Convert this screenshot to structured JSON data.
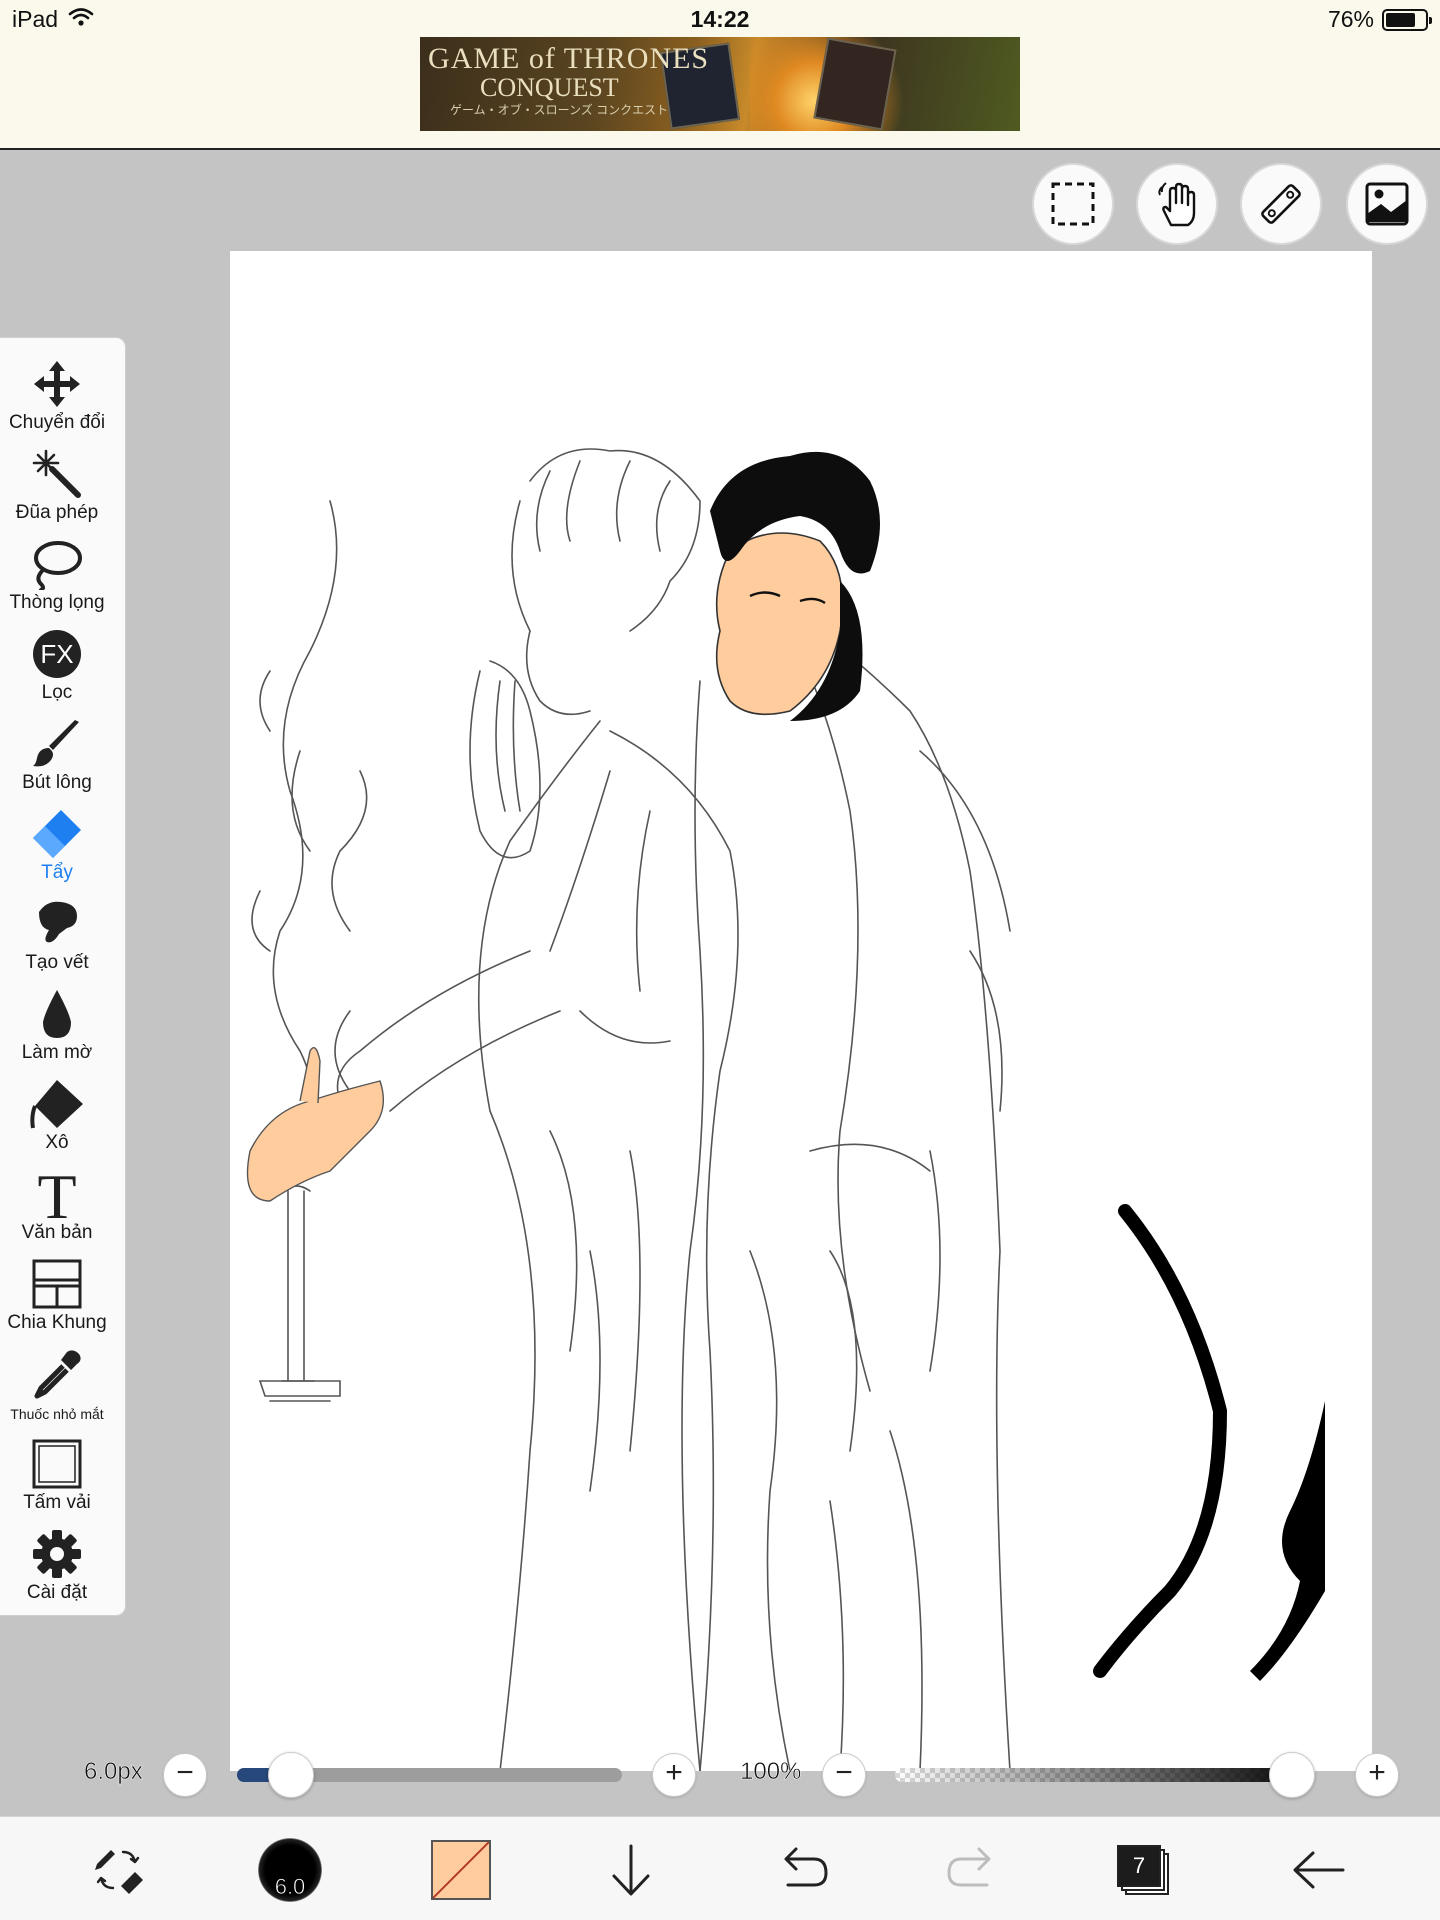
{
  "status_bar": {
    "device": "iPad",
    "time": "14:22",
    "battery": "76%",
    "battery_level": 0.76
  },
  "ad": {
    "title": "GAME of THRONES",
    "subtitle": "CONQUEST",
    "tagline": "ゲーム・オブ・スローンズ コンクエスト"
  },
  "top_tools": [
    {
      "name": "selection-icon"
    },
    {
      "name": "hand-icon"
    },
    {
      "name": "ruler-icon"
    },
    {
      "name": "image-icon"
    }
  ],
  "left_tools": [
    {
      "label": "Chuyển đổi",
      "icon": "move-icon",
      "active": false
    },
    {
      "label": "Đũa phép",
      "icon": "magic-wand-icon",
      "active": false
    },
    {
      "label": "Thòng lọng",
      "icon": "lasso-icon",
      "active": false
    },
    {
      "label": "Lọc",
      "icon": "fx-filter-icon",
      "active": false
    },
    {
      "label": "Bút lông",
      "icon": "brush-icon",
      "active": false
    },
    {
      "label": "Tẩy",
      "icon": "eraser-icon",
      "active": true
    },
    {
      "label": "Tạo vết",
      "icon": "smudge-icon",
      "active": false
    },
    {
      "label": "Làm mờ",
      "icon": "blur-drop-icon",
      "active": false
    },
    {
      "label": "Xô",
      "icon": "bucket-icon",
      "active": false
    },
    {
      "label": "Văn bản",
      "icon": "text-icon",
      "active": false
    },
    {
      "label": "Chia Khung",
      "icon": "frame-divider-icon",
      "active": false
    },
    {
      "label": "Thuốc nhỏ mắt",
      "icon": "eyedropper-icon",
      "active": false
    },
    {
      "label": "Tấm vải",
      "icon": "canvas-icon",
      "active": false
    },
    {
      "label": "Cài đặt",
      "icon": "gear-icon",
      "active": false
    }
  ],
  "sliders": {
    "size_label": "6.0px",
    "size_fraction": 0.08,
    "opacity_label": "100%",
    "opacity_fraction": 1.0,
    "minus": "−",
    "plus": "+"
  },
  "bottom_bar": {
    "brush_size": "6.0",
    "color": "#ffcc9e",
    "layer_count": "7"
  },
  "colors": {
    "accent": "#1d7ff0",
    "skin": "#ffcc9e",
    "size_slider_fill": "#26487a"
  }
}
